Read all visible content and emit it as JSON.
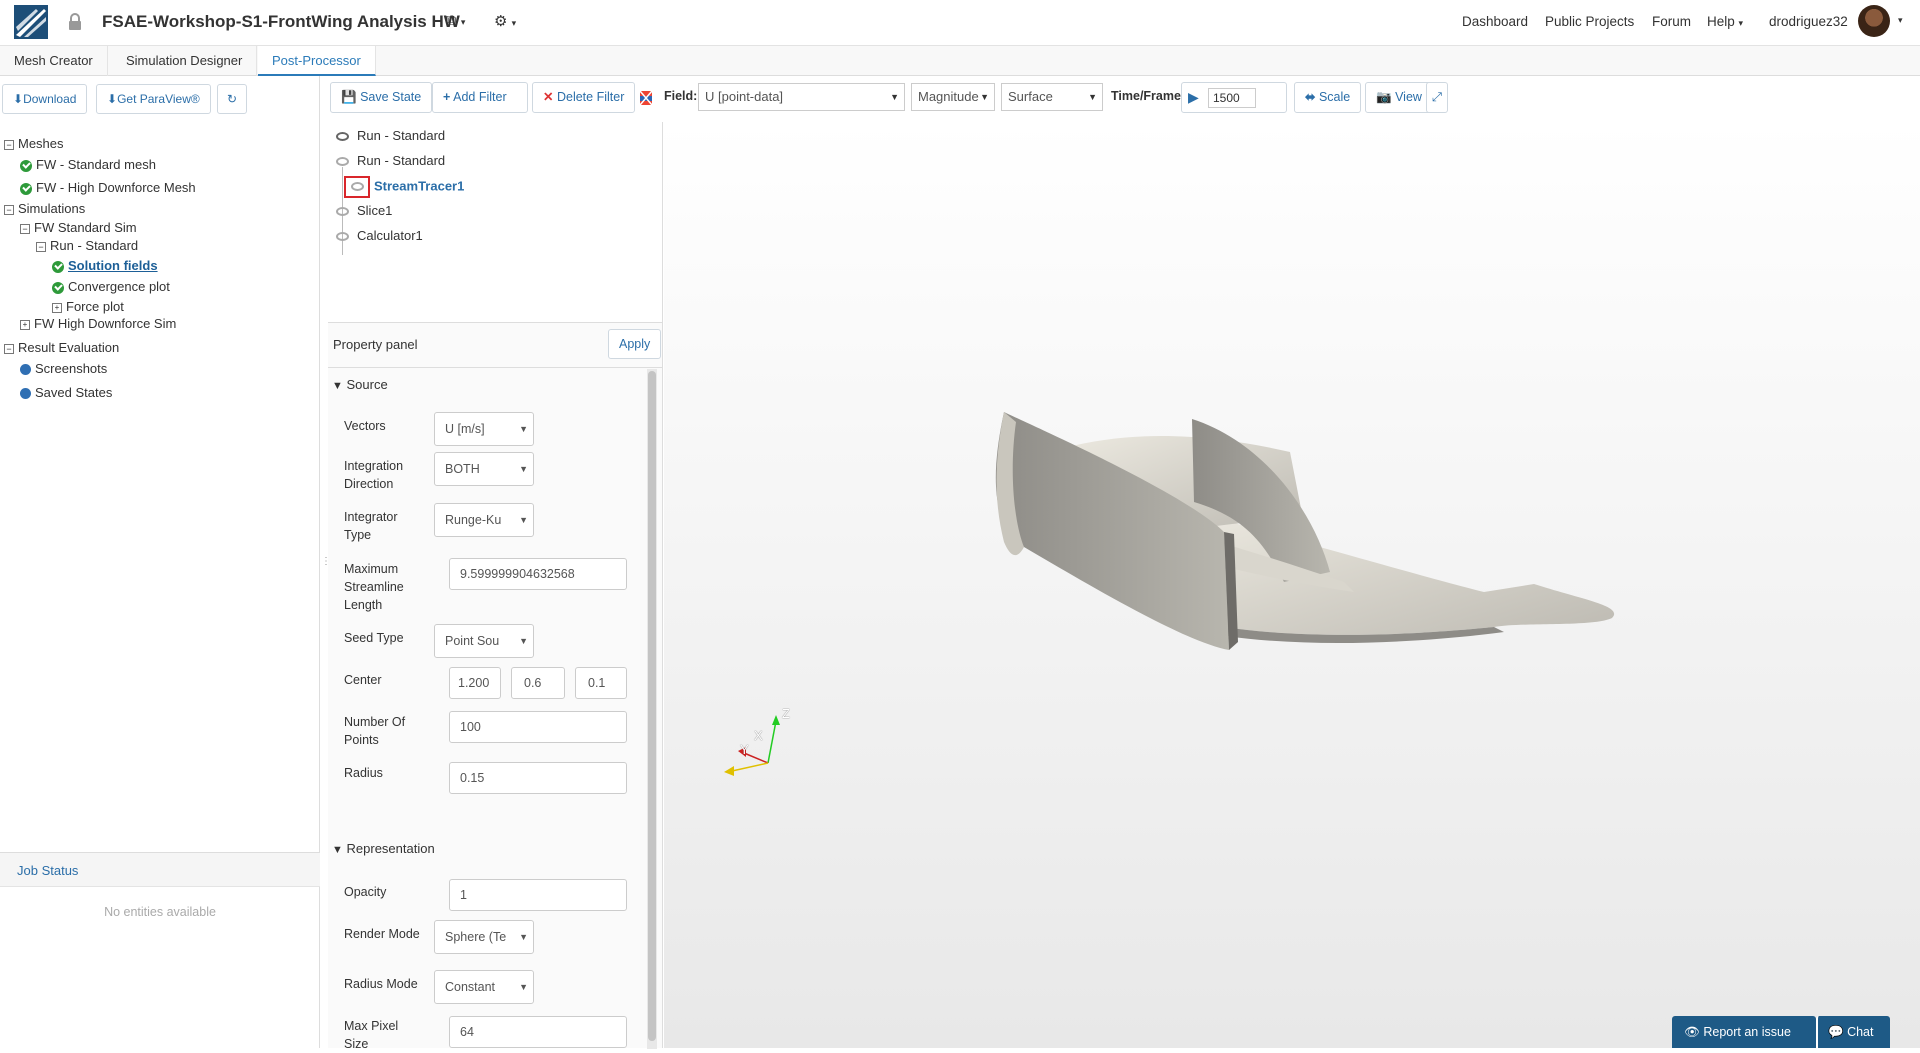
{
  "header": {
    "title": "FSAE-Workshop-S1-FrontWing Analysis HW",
    "nav": [
      "Dashboard",
      "Public Projects",
      "Forum",
      "Help"
    ],
    "user": "drodriguez32"
  },
  "tabs": [
    "Mesh Creator",
    "Simulation Designer",
    "Post-Processor"
  ],
  "left": {
    "buttons": {
      "download": "Download",
      "paraview": "Get ParaView®"
    },
    "tree": {
      "meshes": "Meshes",
      "mesh1": "FW - Standard mesh",
      "mesh2": "FW - High Downforce Mesh",
      "simulations": "Simulations",
      "sim1": "FW Standard Sim",
      "run1": "Run - Standard",
      "solution": "Solution fields",
      "convergence": "Convergence plot",
      "force": "Force plot",
      "sim2": "FW High Downforce Sim",
      "result": "Result Evaluation",
      "screenshots": "Screenshots",
      "saved": "Saved States"
    },
    "job_status": "Job Status",
    "no_entities": "No entities available"
  },
  "toolbar": {
    "save_state": "Save State",
    "add_filter": "Add Filter",
    "delete_filter": "Delete Filter",
    "field_label": "Field:",
    "field_value": "U [point-data]",
    "magnitude": "Magnitude",
    "surface": "Surface",
    "time_label": "Time/Frame:",
    "time_value": "1500",
    "scale": "Scale",
    "view": "View"
  },
  "pipeline": [
    "Run - Standard",
    "Run - Standard",
    "StreamTracer1",
    "Slice1",
    "Calculator1"
  ],
  "property_panel": {
    "title": "Property panel",
    "apply": "Apply",
    "source": "Source",
    "vectors_label": "Vectors",
    "vectors_value": "U [m/s]",
    "integration_dir_label": "Integration Direction",
    "integration_dir_value": "BOTH",
    "integrator_type_label": "Integrator Type",
    "integrator_type_value": "Runge-Ku",
    "max_len_label": "Maximum Streamline Length",
    "max_len_value": "9.599999904632568",
    "seed_type_label": "Seed Type",
    "seed_type_value": "Point Sou",
    "center_label": "Center",
    "center_x": "1.200",
    "center_y": "0.6",
    "center_z": "0.1",
    "num_points_label": "Number Of Points",
    "num_points_value": "100",
    "radius_label": "Radius",
    "radius_value": "0.15",
    "representation": "Representation",
    "opacity_label": "Opacity",
    "opacity_value": "1",
    "render_mode_label": "Render Mode",
    "render_mode_value": "Sphere (Te",
    "radius_mode_label": "Radius Mode",
    "radius_mode_value": "Constant",
    "max_pixel_label": "Max Pixel Size",
    "max_pixel_value": "64"
  },
  "axes": {
    "x": "X",
    "y": "Y",
    "z": "Z"
  },
  "footer": {
    "report": "Report an issue",
    "chat": "Chat"
  }
}
